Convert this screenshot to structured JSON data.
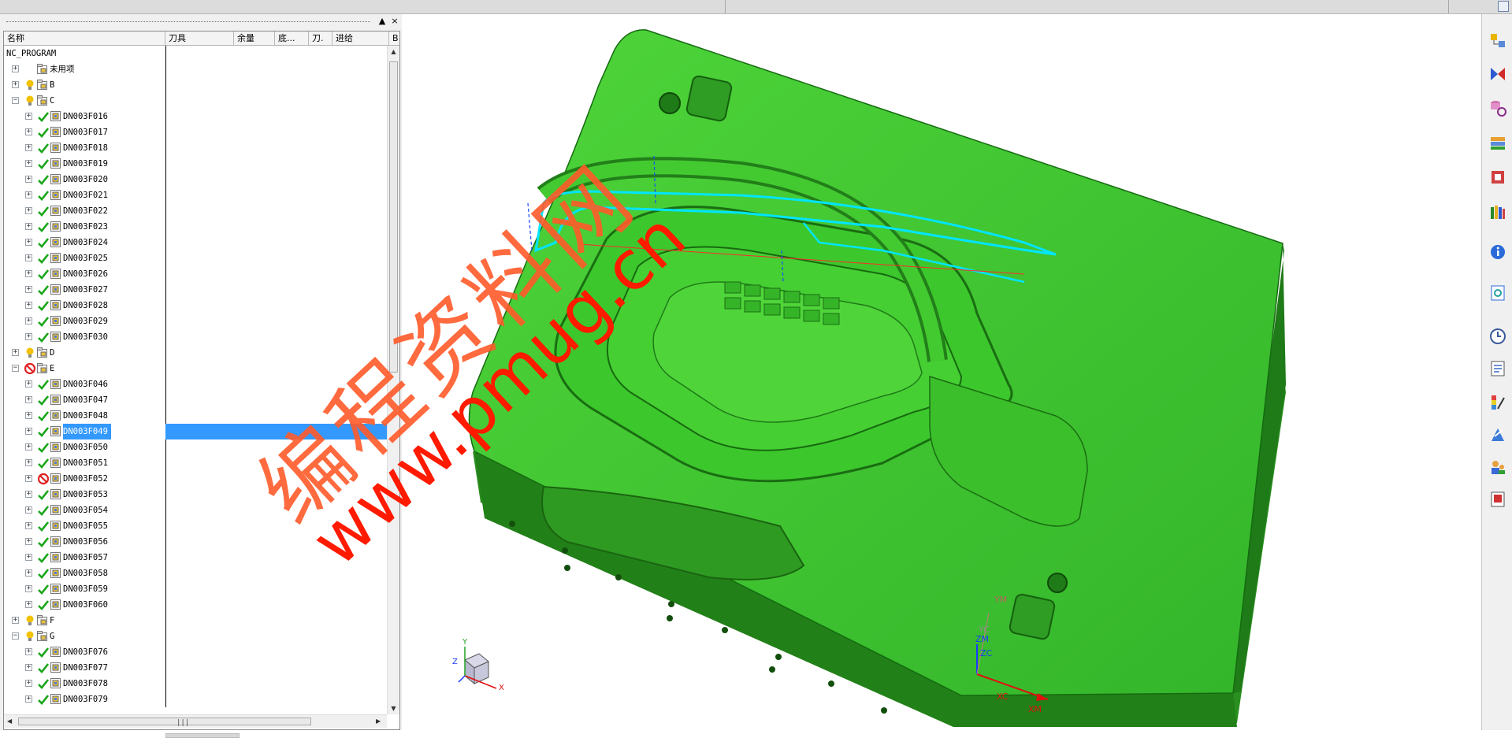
{
  "navigator": {
    "columns": [
      "名称",
      "刀具",
      "余量",
      "底...",
      "刀.",
      "进给",
      "B"
    ],
    "controls": {
      "pin": "▲",
      "close": "×"
    },
    "rows": [
      {
        "label": "NC_PROGRAM",
        "level": 0,
        "expander": "",
        "status": "",
        "op": false
      },
      {
        "label": "未用项",
        "level": 1,
        "expander": "+",
        "status": "",
        "op": true
      },
      {
        "label": "B",
        "level": 1,
        "expander": "+",
        "status": "bulb",
        "op": true
      },
      {
        "label": "C",
        "level": 1,
        "expander": "-",
        "status": "bulb",
        "op": true
      },
      {
        "label": "DN003F016",
        "level": 2,
        "expander": "+",
        "status": "check",
        "op": true
      },
      {
        "label": "DN003F017",
        "level": 2,
        "expander": "+",
        "status": "check",
        "op": true
      },
      {
        "label": "DN003F018",
        "level": 2,
        "expander": "+",
        "status": "check",
        "op": true
      },
      {
        "label": "DN003F019",
        "level": 2,
        "expander": "+",
        "status": "check",
        "op": true
      },
      {
        "label": "DN003F020",
        "level": 2,
        "expander": "+",
        "status": "check",
        "op": true
      },
      {
        "label": "DN003F021",
        "level": 2,
        "expander": "+",
        "status": "check",
        "op": true
      },
      {
        "label": "DN003F022",
        "level": 2,
        "expander": "+",
        "status": "check",
        "op": true
      },
      {
        "label": "DN003F023",
        "level": 2,
        "expander": "+",
        "status": "check",
        "op": true
      },
      {
        "label": "DN003F024",
        "level": 2,
        "expander": "+",
        "status": "check",
        "op": true
      },
      {
        "label": "DN003F025",
        "level": 2,
        "expander": "+",
        "status": "check",
        "op": true
      },
      {
        "label": "DN003F026",
        "level": 2,
        "expander": "+",
        "status": "check",
        "op": true
      },
      {
        "label": "DN003F027",
        "level": 2,
        "expander": "+",
        "status": "check",
        "op": true
      },
      {
        "label": "DN003F028",
        "level": 2,
        "expander": "+",
        "status": "check",
        "op": true
      },
      {
        "label": "DN003F029",
        "level": 2,
        "expander": "+",
        "status": "check",
        "op": true
      },
      {
        "label": "DN003F030",
        "level": 2,
        "expander": "+",
        "status": "check",
        "op": true
      },
      {
        "label": "D",
        "level": 1,
        "expander": "+",
        "status": "bulb",
        "op": true
      },
      {
        "label": "E",
        "level": 1,
        "expander": "-",
        "status": "noentry",
        "op": true
      },
      {
        "label": "DN003F046",
        "level": 2,
        "expander": "+",
        "status": "check",
        "op": true
      },
      {
        "label": "DN003F047",
        "level": 2,
        "expander": "+",
        "status": "check",
        "op": true
      },
      {
        "label": "DN003F048",
        "level": 2,
        "expander": "+",
        "status": "check",
        "op": true
      },
      {
        "label": "DN003F049",
        "level": 2,
        "expander": "+",
        "status": "check",
        "op": true,
        "selected": true
      },
      {
        "label": "DN003F050",
        "level": 2,
        "expander": "+",
        "status": "check",
        "op": true
      },
      {
        "label": "DN003F051",
        "level": 2,
        "expander": "+",
        "status": "check",
        "op": true
      },
      {
        "label": "DN003F052",
        "level": 2,
        "expander": "+",
        "status": "noentry",
        "op": true
      },
      {
        "label": "DN003F053",
        "level": 2,
        "expander": "+",
        "status": "check",
        "op": true
      },
      {
        "label": "DN003F054",
        "level": 2,
        "expander": "+",
        "status": "check",
        "op": true
      },
      {
        "label": "DN003F055",
        "level": 2,
        "expander": "+",
        "status": "check",
        "op": true
      },
      {
        "label": "DN003F056",
        "level": 2,
        "expander": "+",
        "status": "check",
        "op": true
      },
      {
        "label": "DN003F057",
        "level": 2,
        "expander": "+",
        "status": "check",
        "op": true
      },
      {
        "label": "DN003F058",
        "level": 2,
        "expander": "+",
        "status": "check",
        "op": true
      },
      {
        "label": "DN003F059",
        "level": 2,
        "expander": "+",
        "status": "check",
        "op": true
      },
      {
        "label": "DN003F060",
        "level": 2,
        "expander": "+",
        "status": "check",
        "op": true
      },
      {
        "label": "F",
        "level": 1,
        "expander": "+",
        "status": "bulb",
        "op": true
      },
      {
        "label": "G",
        "level": 1,
        "expander": "-",
        "status": "bulb",
        "op": true
      },
      {
        "label": "DN003F076",
        "level": 2,
        "expander": "+",
        "status": "check",
        "op": true
      },
      {
        "label": "DN003F077",
        "level": 2,
        "expander": "+",
        "status": "check",
        "op": true
      },
      {
        "label": "DN003F078",
        "level": 2,
        "expander": "+",
        "status": "check",
        "op": true
      },
      {
        "label": "DN003F079",
        "level": 2,
        "expander": "+",
        "status": "check",
        "op": true
      }
    ]
  },
  "viewport": {
    "axes_labels": {
      "yc": "YC",
      "ym": "YM",
      "zm": "ZM",
      "zc": "ZC",
      "xc": "XC",
      "xm": "XM"
    },
    "triad_labels": {
      "x": "X",
      "y": "Y",
      "z": "Z"
    },
    "colors": {
      "part": "#3fbf2f",
      "part_dark": "#1f7a18",
      "toolpath": "#00e5ff",
      "background": "#ffffff"
    }
  },
  "watermark": {
    "line1": "编程资料网",
    "line2": "www.pmug.cn"
  },
  "right_toolbar": {
    "icons": [
      "assembly-navigator-icon",
      "constraint-navigator-icon",
      "part-navigator-icon",
      "reuse-library-icon",
      "hd3d-tools-icon",
      "web-browser-icon",
      "info-icon",
      "history-icon",
      "clock-icon",
      "process-navigator-icon",
      "visualization-icon",
      "roles-icon",
      "manufacturing-wizard-icon",
      "system-materials-icon"
    ]
  },
  "colors": {
    "selection": "#3399ff",
    "check": "#1aa51a",
    "noentry": "#e02020",
    "bulb": "#f2c200"
  }
}
